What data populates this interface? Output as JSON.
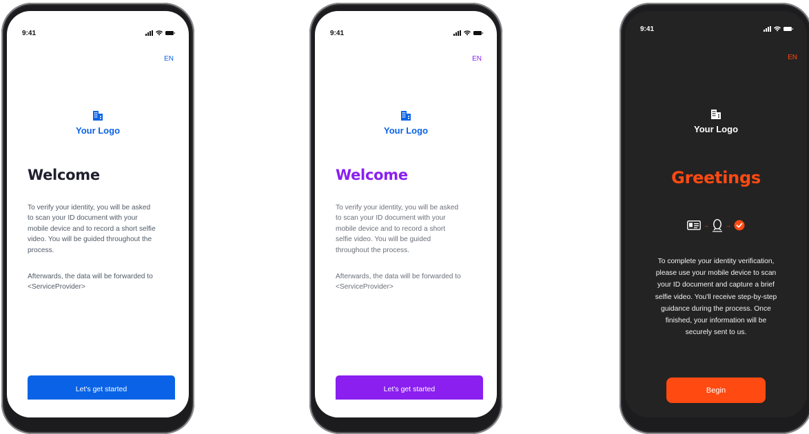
{
  "colors": {
    "blue": "#0a63e6",
    "purple": "#8a1ff0",
    "orange": "#ff4a12",
    "title_dark": "#1f1f2e",
    "dark_bg": "#232323"
  },
  "screens": [
    {
      "variant": "blue",
      "status_time": "9:41",
      "lang": "EN",
      "logo_icon": "building-icon",
      "logo_text": "Your Logo",
      "title": "Welcome",
      "body_lines": [
        "To verify your identity, you will be asked",
        "to scan your ID document with your",
        "mobile device and to record a short selfie",
        "video. You will be guided throughout the",
        "process."
      ],
      "footer_lines": [
        "Afterwards, the data will be forwarded to",
        "<ServiceProvider>"
      ],
      "button_label": "Let's get started"
    },
    {
      "variant": "purple",
      "status_time": "9:41",
      "lang": "EN",
      "logo_icon": "building-icon",
      "logo_text": "Your Logo",
      "title": "Welcome",
      "body_lines": [
        "To verify your identity, you will be asked",
        "to scan your ID document with your",
        "mobile device and to record a short",
        "selfie video. You will be guided",
        "throughout the process."
      ],
      "footer_lines": [
        "Afterwards, the data will be forwarded to",
        "<ServiceProvider>"
      ],
      "button_label": "Let's get started"
    },
    {
      "variant": "dark",
      "status_time": "9:41",
      "lang": "EN",
      "logo_icon": "building-icon",
      "logo_text": "Your Logo",
      "title": "Greetings",
      "flow_icons": [
        "id-card-icon",
        "face-scan-icon",
        "check-circle-icon"
      ],
      "body_lines": [
        "To complete your identity verification,",
        "please use your mobile device to scan",
        "your ID document and capture a brief",
        "selfie video. You'll receive step-by-step",
        "guidance during the process. Once",
        "finished, your information will be",
        "securely sent to us."
      ],
      "button_label": "Begin"
    }
  ]
}
